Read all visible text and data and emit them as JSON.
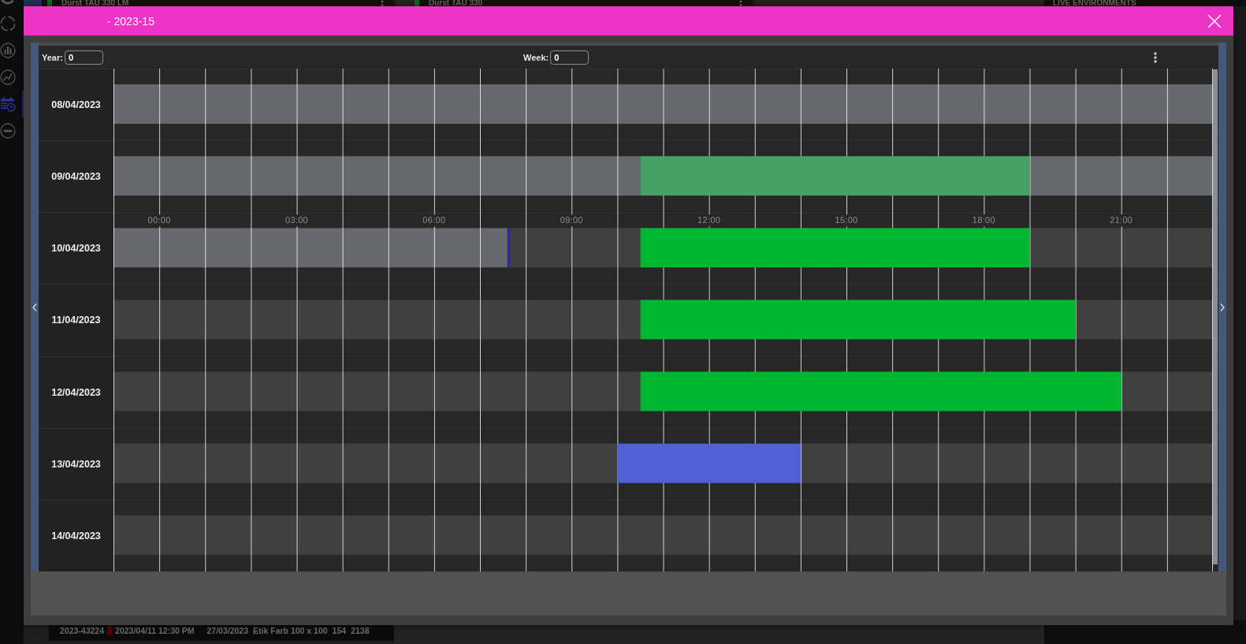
{
  "nav_rail": [
    {
      "selected": false
    },
    {
      "selected": false
    },
    {
      "selected": false
    },
    {
      "selected": false
    },
    {
      "selected": true
    },
    {
      "selected": false
    }
  ],
  "background": {
    "top_cards": [
      {
        "title": "Durst TAU 330 LM",
        "color": "#0f6a1f"
      },
      {
        "title": "Durst TAU 330",
        "color": "#0f6a1f"
      }
    ],
    "side_panel_title": "LIVE ENVIRONMENTS",
    "job_row": {
      "cells": [
        "2023-43224",
        "2023/04/11 12:30 PM",
        "27/03/2023",
        "Etik Farb 100 x 100",
        "154",
        "2138"
      ],
      "color": "#5a0000"
    }
  },
  "dialog": {
    "title": "- 2023-15",
    "year": {
      "label": "Year:",
      "value": "0"
    },
    "week": {
      "label": "Week:",
      "value": "0"
    },
    "schedule": {
      "chart_data": {
        "type": "bar",
        "orientation": "horizontal",
        "stacked": true,
        "grid": true,
        "categories": [
          "08/04/2023",
          "09/04/2023",
          "10/04/2023",
          "11/04/2023",
          "12/04/2023",
          "13/04/2023",
          "14/04/2023"
        ],
        "xlim": [
          -1,
          23
        ],
        "xticks": [
          {
            "value": 0,
            "label": "00:00"
          },
          {
            "value": 3,
            "label": "03:00"
          },
          {
            "value": 6,
            "label": "06:00"
          },
          {
            "value": 9,
            "label": "09:00"
          },
          {
            "value": 12,
            "label": "12:00"
          },
          {
            "value": 15,
            "label": "15:00"
          },
          {
            "value": 18,
            "label": "18:00"
          },
          {
            "value": 21,
            "label": "21:00"
          }
        ],
        "series": [
          {
            "color": "#67686d",
            "values": [
              -1,
              -1,
              -1,
              null,
              null,
              null,
              null
            ]
          },
          {
            "color": "#404040",
            "values": [
              null,
              null,
              null,
              -1,
              -1,
              -1,
              -1
            ]
          },
          {
            "color": "#67686d",
            "values": [
              23,
              10.5,
              7.6,
              null,
              null,
              null,
              null
            ]
          },
          {
            "color": "#2626b8",
            "values": [
              null,
              null,
              0.04,
              null,
              null,
              null,
              null
            ]
          },
          {
            "color": "#404040",
            "values": [
              null,
              null,
              2.86,
              10.5,
              10.5,
              10,
              23
            ]
          },
          {
            "color": "#45a065",
            "values": [
              null,
              8.5,
              null,
              null,
              null,
              null,
              null
            ]
          },
          {
            "color": "#00b731",
            "values": [
              null,
              null,
              8.5,
              9.5,
              10.5,
              null,
              null
            ]
          },
          {
            "color": "#4f61d4",
            "values": [
              null,
              null,
              null,
              null,
              null,
              4,
              null
            ]
          },
          {
            "color": "#67686d",
            "values": [
              null,
              4,
              null,
              null,
              null,
              null,
              null
            ]
          },
          {
            "color": "#404040",
            "values": [
              null,
              null,
              4,
              3,
              2,
              9,
              null
            ]
          }
        ]
      }
    }
  }
}
